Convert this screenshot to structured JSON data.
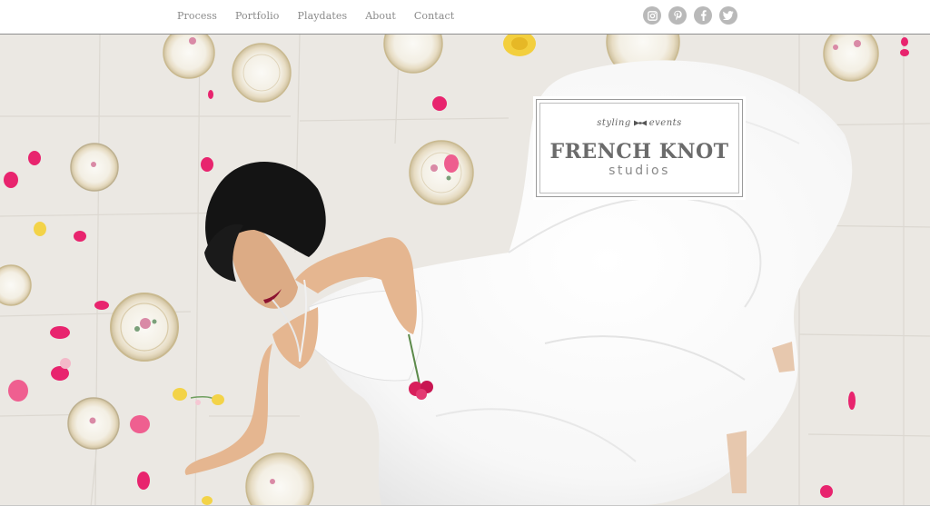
{
  "nav": {
    "items": [
      {
        "label": "Process"
      },
      {
        "label": "Portfolio"
      },
      {
        "label": "Playdates"
      },
      {
        "label": "About"
      },
      {
        "label": "Contact"
      }
    ]
  },
  "social": {
    "icons": [
      "instagram-icon",
      "pinterest-icon",
      "facebook-icon",
      "twitter-icon"
    ],
    "icon_color": "#b9b9b9"
  },
  "logo": {
    "tagline_left": "styling",
    "tagline_right": "events",
    "name": "FRENCH KNOT",
    "subtitle": "studios"
  },
  "slider": {
    "total_slides": 5,
    "active_index": 0
  },
  "colors": {
    "petal_pink": "#e8246e",
    "petal_yellow": "#f3d348",
    "floor": "#ece9e5",
    "lipstick": "#8c1230"
  }
}
